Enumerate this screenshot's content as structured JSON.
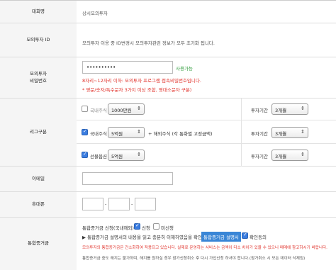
{
  "rows": {
    "company": {
      "label": "대회명",
      "value": "상시모의투자"
    },
    "mock_id": {
      "label": "모의투자 ID",
      "notice": "모의투자 이용 중 ID변경시 모의투자관련 정보가 모두 초기화 됩니다."
    },
    "password": {
      "label_line1": "모의투자",
      "label_line2": "비밀번호",
      "value": "••••••••••",
      "status": "사용가능",
      "rule1": "8자리~12자리 이하: 모의투자 프로그램 접속비밀번호입니다.",
      "rule2": "* 영문/숫자/특수문자 3가지 이상 조합, 영대소문자 구분)"
    },
    "league": {
      "label": "리그구분",
      "domestic_stock": {
        "label": "국내주식",
        "amount": "1000만원",
        "checked": false,
        "period_label": "투자기간",
        "period": "3개월"
      },
      "domestic_stock2": {
        "label": "국내주식",
        "amount": "5억원",
        "checked": true,
        "extra": "+ 해외주식 (각 통화별 고정금액)",
        "period_label": "투자기간",
        "period": "3개월"
      },
      "futures": {
        "label": "선물옵션",
        "amount": "5억원",
        "checked": true,
        "period_label": "투자기간",
        "period": "3개월"
      }
    },
    "email": {
      "label": "이메일",
      "value": ""
    },
    "phone": {
      "label": "휴대폰",
      "sep": "-"
    },
    "consent": {
      "label": "통합증거금",
      "line1_prefix": "통합증거금 신청(국내해외)",
      "apply": "신청",
      "not_apply": "미신청",
      "line2_prefix": "▶ 통합증거금 설명서의 내용을 읽고 충분히 이해하였음을 확인합니다.",
      "guide_link": "통합증거금 설명서",
      "agree": "확인동의",
      "line3": "모의투자의 통합증거금은 간소화하여 적용되고 있습니다. 실제로 운영하는 서비스는 금액이 다소 차이가 있을 수 있으니 매매에 참고하시기 바랍니다.",
      "line4": "통합증거금 중도 해지는 불가하며, 해지를 원하실 경우 참가신청취소 후 다시 가입신청 하셔야 합니다.(참가취소 시 모든 데이터 삭제됨)"
    }
  }
}
